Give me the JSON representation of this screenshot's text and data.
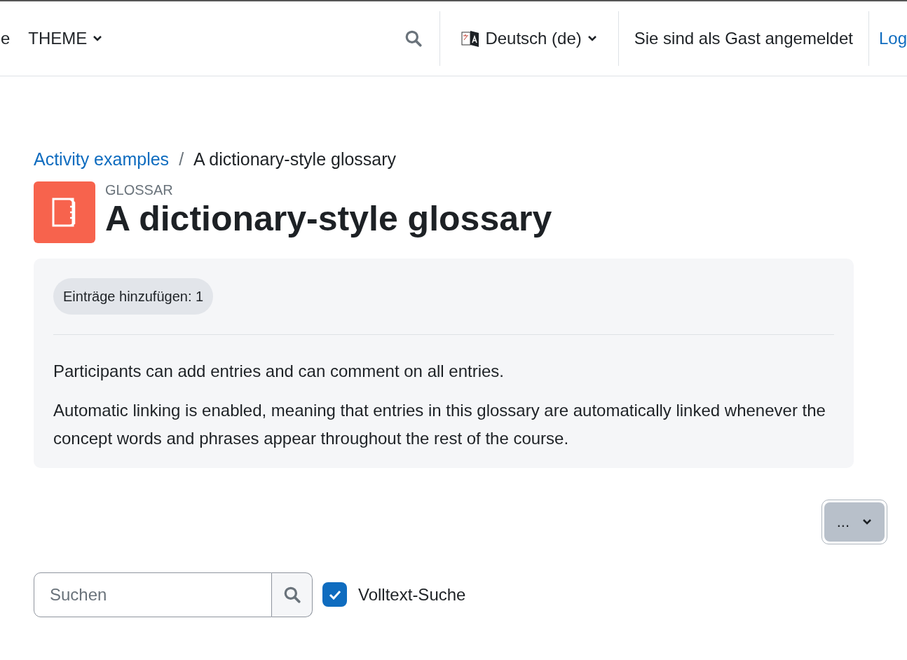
{
  "navbar": {
    "items": [
      {
        "label": "e",
        "kind": "text"
      },
      {
        "label": "THEME",
        "kind": "dropdown"
      }
    ],
    "language": "Deutsch (de)",
    "login_status": "Sie sind als Gast angemeldet",
    "login_link": "Log"
  },
  "breadcrumb_separator": "/",
  "breadcrumb": [
    {
      "label": "Activity examples",
      "kind": "link"
    },
    {
      "label": "A dictionary-style glossary",
      "kind": "current"
    }
  ],
  "header": {
    "type_label": "GLOSSAR",
    "title": "A dictionary-style glossary"
  },
  "info": {
    "badge": "Einträge hinzufügen: 1",
    "paragraphs": [
      "Participants can add entries and can comment on all entries.",
      "Automatic linking is enabled, meaning that entries in this glossary are automatically linked whenever the concept words and phrases appear throughout the rest of the course."
    ]
  },
  "actions_menu": {
    "label": "..."
  },
  "search": {
    "placeholder": "Suchen",
    "fulltext": {
      "label": "Volltext-Suche",
      "checked": true
    }
  }
}
